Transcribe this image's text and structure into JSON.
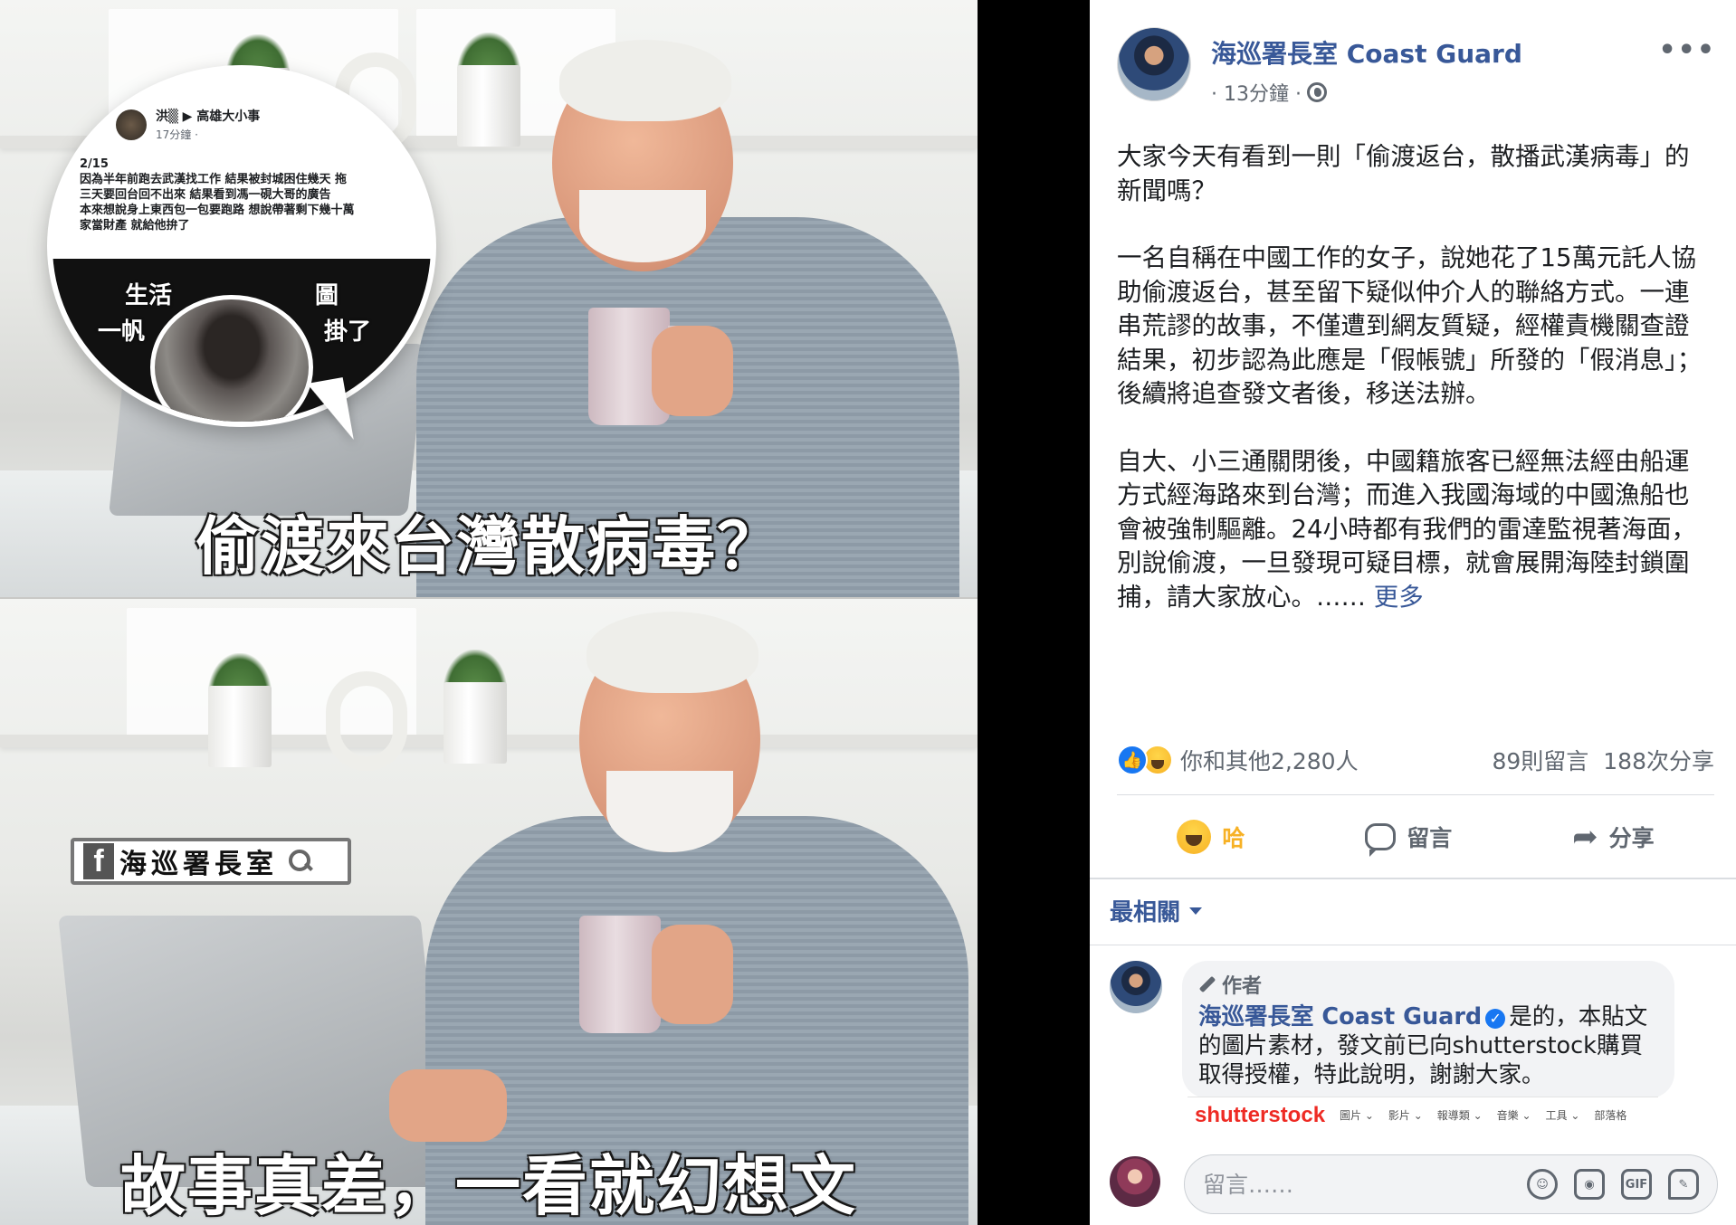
{
  "meme": {
    "top_caption": "偷渡來台灣散病毒？",
    "bottom_caption": "故事真差，一看就幻想文",
    "badge_label": "海巡署長室",
    "screenshot_bubble": {
      "author": "洪▒ ▶ 高雄大小事",
      "time": "17分鐘 · ",
      "lines": [
        "2/15",
        "因為半年前跑去武漢找工作 結果被封城困住幾天 拖",
        "三天要回台回不出來 結果看到馮一硯大哥的廣告",
        "本來想說身上東西包一包要跑路 想說帶著剩下幾十萬",
        "家當財產 就給他拚了"
      ],
      "overlay_1": "生活",
      "overlay_2": "一帆",
      "overlay_3": "圖",
      "overlay_4": "掛了"
    }
  },
  "post": {
    "author": "海巡署長室 Coast Guard",
    "time": "· 13分鐘 ·",
    "more": "•••",
    "paragraphs": [
      "大家今天有看到一則「偷渡返台，散播武漢病毒」的新聞嗎？",
      "一名自稱在中國工作的女子，說她花了15萬元託人協助偷渡返台，甚至留下疑似仲介人的聯絡方式。一連串荒謬的故事，不僅遭到網友質疑，經權責機關查證結果，初步認為此應是「假帳號」所發的「假消息」；後續將追查發文者後，移送法辦。"
    ],
    "para3": "自大、小三通關閉後，中國籍旅客已經無法經由船運方式經海路來到台灣；而進入我國海域的中國漁船也會被強制驅離。24小時都有我們的雷達監視著海面，別說偷渡，一旦發現可疑目標，就會展開海陸封鎖圍捕，請大家放心。……",
    "see_more": "更多",
    "reaction_summary": "你和其他2,280人",
    "comments_count": "89則留言",
    "shares_count": "188次分享",
    "action_haha": "哈",
    "action_comment": "留言",
    "action_share": "分享",
    "sort_label": "最相關",
    "comment": {
      "author_tag": "作者",
      "author": "海巡署長室 Coast Guard",
      "text": "是的，本貼文的圖片素材，發文前已向shutterstock購買取得授權，特此說明，謝謝大家。"
    },
    "shutterstock": {
      "logo": "shutterstock",
      "nav": [
        "圖片 ⌄",
        "影片 ⌄",
        "報導類 ⌄",
        "音樂 ⌄",
        "工具 ⌄",
        "部落格"
      ]
    },
    "comment_input_placeholder": "留言……",
    "tools": [
      "☺",
      "◉",
      "GIF",
      "✎"
    ]
  }
}
